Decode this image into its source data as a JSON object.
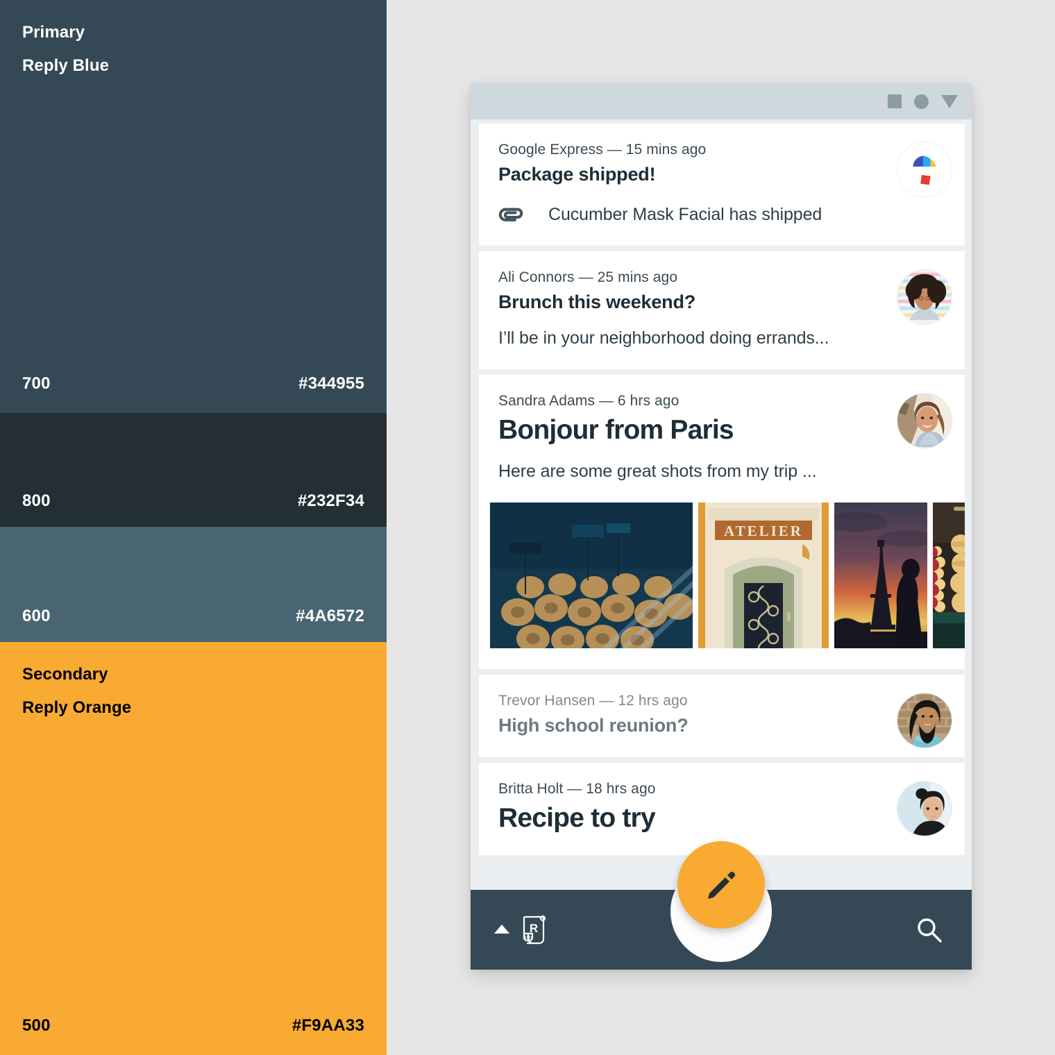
{
  "palette": {
    "swatches": [
      {
        "role": "Primary",
        "name": "Reply Blue",
        "tone": "700",
        "hex": "#344955",
        "text": "light"
      },
      {
        "role": "",
        "name": "",
        "tone": "800",
        "hex": "#232F34",
        "text": "light"
      },
      {
        "role": "",
        "name": "",
        "tone": "600",
        "hex": "#4A6572",
        "text": "light"
      },
      {
        "role": "Secondary",
        "name": "Reply Orange",
        "tone": "500",
        "hex": "#F9AA33",
        "text": "dark"
      }
    ]
  },
  "window": {
    "chrome_controls": [
      "minimize-square",
      "maximize-circle",
      "close-triangle"
    ]
  },
  "inbox": {
    "messages": [
      {
        "sender": "Google Express",
        "time": "15 mins ago",
        "meta": "Google Express — 15 mins ago",
        "subject": "Package shipped!",
        "attachment_label": "Cucumber Mask Facial has shipped",
        "avatar": "google-express-parachute-logo",
        "state": "unread"
      },
      {
        "sender": "Ali Connors",
        "time": "25 mins ago",
        "meta": "Ali Connors — 25 mins ago",
        "subject": "Brunch this weekend?",
        "snippet": "I’ll be in your neighborhood doing errands...",
        "avatar": "ali-connors-photo",
        "state": "unread"
      },
      {
        "sender": "Sandra Adams",
        "time": "6 hrs ago",
        "meta": "Sandra Adams — 6 hrs ago",
        "subject": "Bonjour from Paris",
        "snippet": "Here are some great shots from my trip ...",
        "avatar": "sandra-adams-photo",
        "state": "expanded",
        "photos": [
          "paris-bakery-pastries",
          "atelier-doorway",
          "eiffel-tower-sunset",
          "macarons-display"
        ]
      },
      {
        "sender": "Trevor Hansen",
        "time": "12 hrs ago",
        "meta": "Trevor Hansen — 12 hrs ago",
        "subject": "High school reunion?",
        "avatar": "trevor-hansen-photo",
        "state": "read"
      },
      {
        "sender": "Britta Holt",
        "time": "18 hrs ago",
        "meta": "Britta Holt — 18 hrs ago",
        "subject": "Recipe to try",
        "avatar": "britta-holt-photo",
        "state": "unread"
      }
    ]
  },
  "appbar": {
    "menu_icon": "up-triangle-icon",
    "brand_icon": "reply-logo-icon",
    "compose_label": "edit-pencil-icon",
    "search_label": "search-icon",
    "background": "#344955",
    "fab_color": "#F9AA33"
  }
}
